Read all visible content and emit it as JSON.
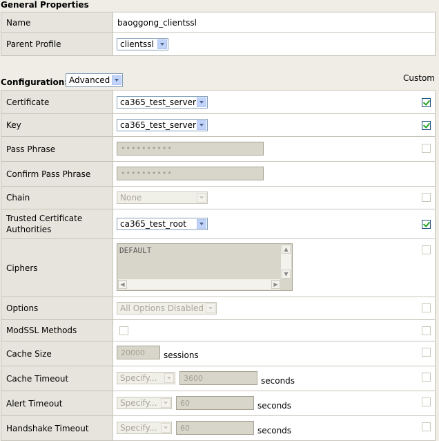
{
  "general": {
    "title": "General Properties",
    "rows": {
      "name": {
        "label": "Name",
        "value": "baoggong_clientssl"
      },
      "parent": {
        "label": "Parent Profile",
        "value": "clientssl"
      }
    }
  },
  "configuration": {
    "title": "Configuration:",
    "mode": "Advanced",
    "custom_header": "Custom",
    "rows": {
      "certificate": {
        "label": "Certificate",
        "value": "ca365_test_server",
        "custom": true
      },
      "key": {
        "label": "Key",
        "value": "ca365_test_server",
        "custom": true
      },
      "pass_phrase": {
        "label": "Pass Phrase",
        "value": "••••••••••",
        "custom": false
      },
      "confirm_pass_phrase": {
        "label": "Confirm Pass Phrase",
        "value": "••••••••••"
      },
      "chain": {
        "label": "Chain",
        "value": "None",
        "custom": false
      },
      "trusted_ca": {
        "label_line1": "Trusted Certificate",
        "label_line2": "Authorities",
        "value": "ca365_test_root",
        "custom": true
      },
      "ciphers": {
        "label": "Ciphers",
        "value": "DEFAULT",
        "custom": false
      },
      "options": {
        "label": "Options",
        "value": "All Options Disabled",
        "custom": false
      },
      "modssl": {
        "label": "ModSSL Methods",
        "custom": false
      },
      "cache_size": {
        "label": "Cache Size",
        "value": "20000",
        "unit": "sessions",
        "custom": false
      },
      "cache_timeout": {
        "label": "Cache Timeout",
        "mode": "Specify...",
        "value": "3600",
        "unit": "seconds",
        "custom": false
      },
      "alert_timeout": {
        "label": "Alert Timeout",
        "mode": "Specify...",
        "value": "60",
        "unit": "seconds",
        "custom": false
      },
      "handshake_timeout": {
        "label": "Handshake Timeout",
        "mode": "Specify...",
        "value": "60",
        "unit": "seconds",
        "custom": false
      }
    }
  },
  "icons": {
    "dropdown": "chevron-down-icon",
    "scroll_up": "arrow-up-icon",
    "scroll_down": "arrow-down-icon",
    "scroll_left": "arrow-left-icon",
    "scroll_right": "arrow-right-icon",
    "checkmark": "checkmark-icon"
  },
  "colors": {
    "label_bg": "#e6e4dc",
    "value_bg": "#ffffff",
    "page_bg": "#efede6",
    "checkmark": "#21a121",
    "disabled_field": "#d8d6ca"
  }
}
